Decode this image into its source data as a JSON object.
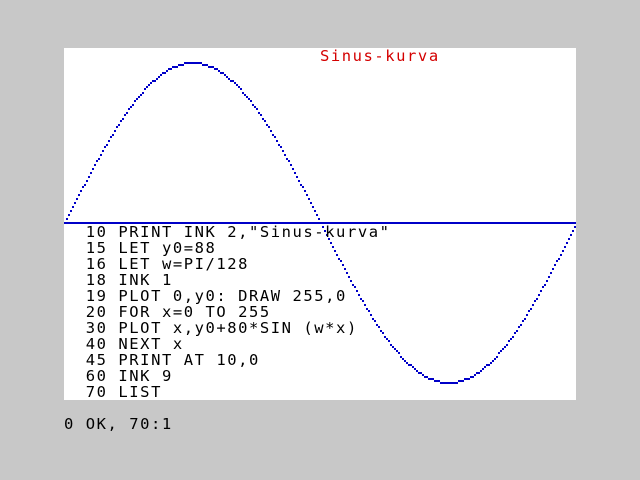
{
  "screen": {
    "title_text": "Sinus-kurva",
    "title_color": "#d40000",
    "ink_color": "#0000c8",
    "paper_color": "#ffffff",
    "border_color": "#c8c8c8"
  },
  "program": [
    {
      "num": "10",
      "code": "PRINT INK 2,\"Sinus-kurva\""
    },
    {
      "num": "15",
      "code": "LET y0=88"
    },
    {
      "num": "16",
      "code": "LET w=PI/128"
    },
    {
      "num": "18",
      "code": "INK 1"
    },
    {
      "num": "19",
      "code": "PLOT 0,y0: DRAW 255,0"
    },
    {
      "num": "20",
      "code": "FOR x=0 TO 255"
    },
    {
      "num": "30",
      "code": "PLOT x,y0+80*SIN (w*x)"
    },
    {
      "num": "40",
      "code": "NEXT x"
    },
    {
      "num": "45",
      "code": "PRINT AT 10,0"
    },
    {
      "num": "60",
      "code": "INK 9"
    },
    {
      "num": "70",
      "code": "LIST"
    }
  ],
  "status": {
    "message": "0 OK, 70:1"
  }
}
